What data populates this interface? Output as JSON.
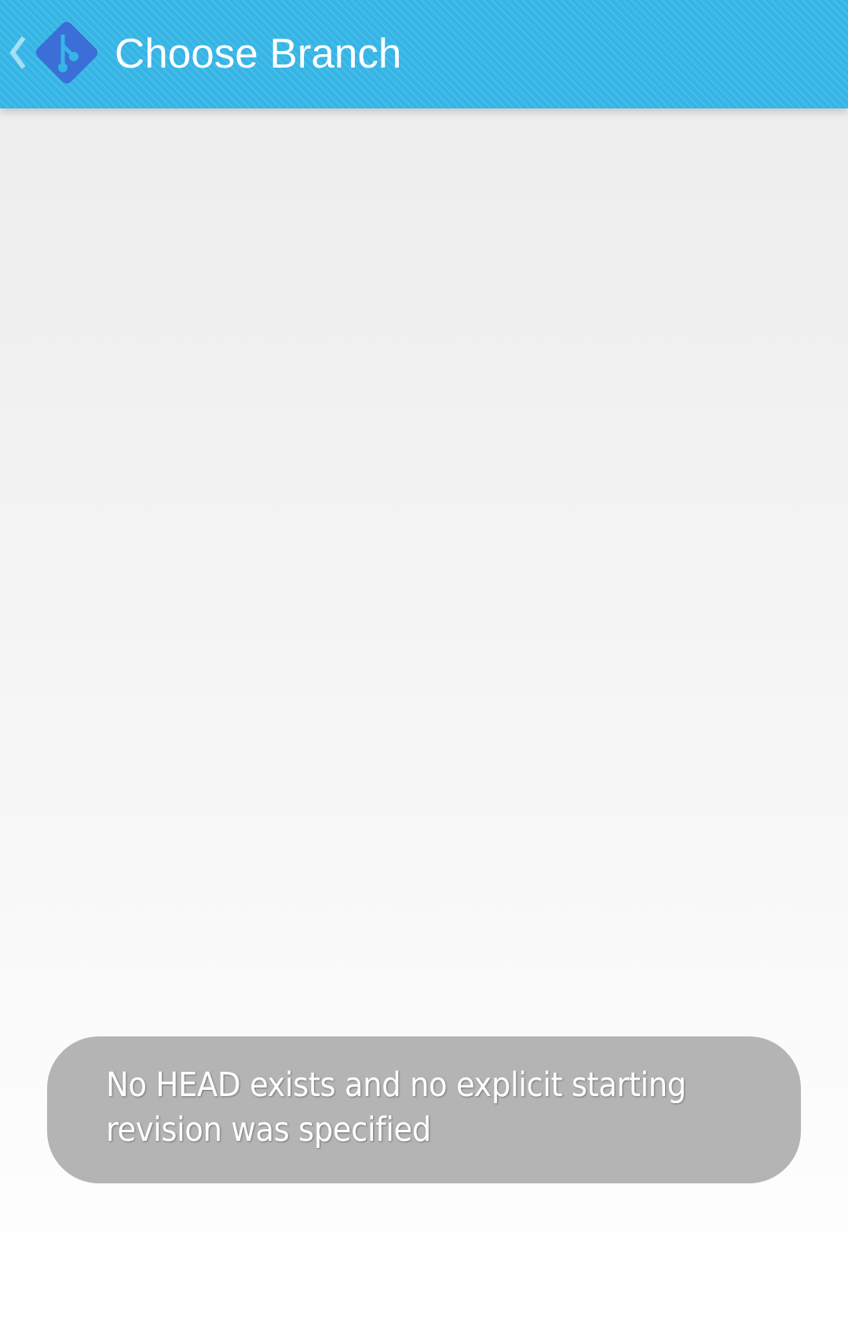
{
  "action_bar": {
    "title": "Choose Branch",
    "up_icon": "chevron-left-icon",
    "logo_icon": "git-logo-icon",
    "colors": {
      "background": "#35b5e5",
      "logo": "#3b6ed6",
      "title_text": "#ffffff"
    }
  },
  "toast": {
    "message": "No HEAD exists and no explicit starting revision was specified",
    "colors": {
      "background": "#b4b4b4",
      "text": "#ffffff"
    }
  }
}
